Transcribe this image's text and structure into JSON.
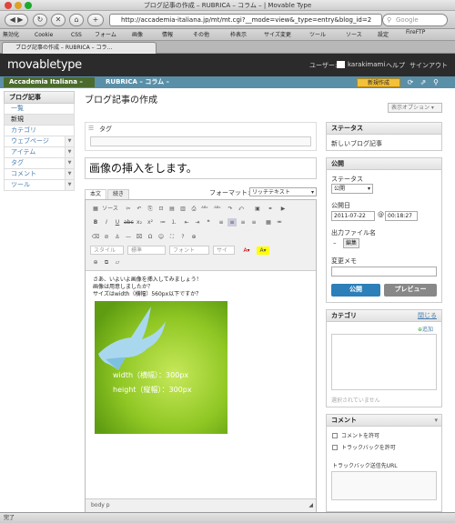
{
  "browser": {
    "window_title": "ブログ記事の作成 – RUBRICA – コラム – | Movable Type",
    "url": "http://accademia-italiana.jp/mt/mt.cgi?__mode=view&_type=entry&blog_id=2",
    "search_placeholder": "Google",
    "tab_title": "ブログ記事の作成 – RUBRICA – コラ...",
    "bookmarks": [
      "無効化",
      "Cookie",
      "CSS",
      "フォーム",
      "画像",
      "情報",
      "その他",
      "枠表示",
      "サイズ変更",
      "ツール",
      "ソース",
      "設定"
    ],
    "firefox_tool": "FireFTP",
    "status_text": "完了"
  },
  "mt": {
    "logo": "movabletype",
    "user_label": "ユーザー:",
    "username": "karakimami",
    "help": "ヘルプ",
    "signout": "サインアウト",
    "site_name": "Accademia Italiana – 本",
    "blog_name": "RUBRICA – コラム –",
    "new_button": "新規作成"
  },
  "sidebar": {
    "heading": "ブログ記事",
    "items": [
      {
        "label": "一覧"
      },
      {
        "label": "新規"
      },
      {
        "label": "カテゴリ"
      }
    ],
    "groups": [
      {
        "label": "ウェブページ"
      },
      {
        "label": "アイテム"
      },
      {
        "label": "タグ"
      },
      {
        "label": "コメント"
      },
      {
        "label": "ツール"
      }
    ]
  },
  "main": {
    "page_title": "ブログ記事の作成",
    "display_options": "表示オプション",
    "tag_label": "タグ",
    "title_value": "画像の挿入をします。",
    "tab_body": "本文",
    "tab_more": "続き",
    "format_label": "フォーマット:",
    "format_value": "リッチテキスト",
    "toolbar": {
      "source": "ソース",
      "style": "スタイル",
      "standard": "標準",
      "font": "フォント",
      "size": "サイ"
    },
    "content_lines": [
      "さあ、いよいよ画像を挿入してみましょう！",
      "画像は用意しましたか？",
      "サイズはwidth（横幅）560px以下ですか？"
    ],
    "image_text_1": "width（横幅）：300px",
    "image_text_2": "height（縦幅）：300px",
    "path": "body  p"
  },
  "right": {
    "status_head": "ステータス",
    "status_value": "新しいブログ記事",
    "publish_head": "公開",
    "status_label": "ステータス",
    "status_select": "公開",
    "date_label": "公開日",
    "date_value": "2011-07-22",
    "time_value": "00:18:27",
    "filename_label": "出力ファイル名",
    "edit_button": "編集",
    "memo_label": "変更メモ",
    "publish_button": "公開",
    "preview_button": "プレビュー",
    "category_head": "カテゴリ",
    "close_link": "閉じる",
    "add_link": "追加",
    "no_selection": "選択されていません",
    "comment_head": "コメント",
    "allow_comments": "コメントを許可",
    "allow_trackbacks": "トラックバックを許可",
    "trackback_url_label": "トラックバック送信先URL"
  }
}
